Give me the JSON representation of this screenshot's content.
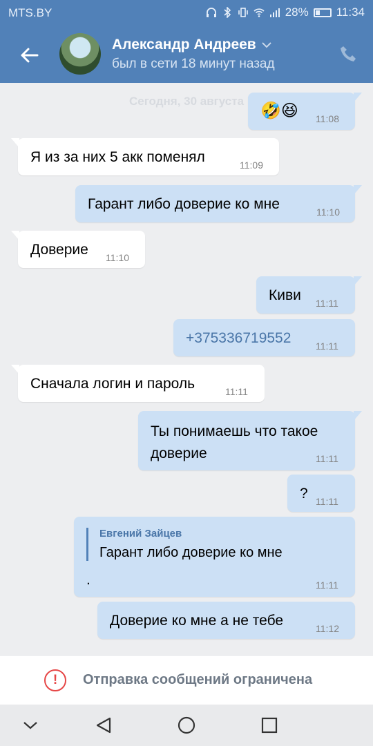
{
  "status_bar": {
    "carrier": "MTS.BY",
    "battery": "28%",
    "time": "11:34"
  },
  "header": {
    "name": "Александр Андреев",
    "last_seen": "был в сети 18 минут назад"
  },
  "chat": {
    "date_divider": "Сегодня, 30 августа",
    "messages": [
      {
        "dir": "out",
        "text": "🤣😆",
        "time": "11:08"
      },
      {
        "dir": "in",
        "text": "Я из за них 5 акк поменял",
        "time": "11:09"
      },
      {
        "dir": "out",
        "text": "Гарант либо доверие ко мне",
        "time": "11:10"
      },
      {
        "dir": "in",
        "text": "Доверие",
        "time": "11:10"
      },
      {
        "dir": "out",
        "text": "Киви",
        "time": "11:11"
      },
      {
        "dir": "out",
        "text": "+375336719552",
        "time": "11:11"
      },
      {
        "dir": "in",
        "text": "Сначала логин и пароль",
        "time": "11:11"
      },
      {
        "dir": "out",
        "text": "Ты понимаешь что такое доверие",
        "time": "11:11"
      },
      {
        "dir": "out",
        "text": "?",
        "time": "11:11"
      },
      {
        "dir": "out",
        "text": ".",
        "time": "11:11",
        "reply_author": "Евгений Зайцев",
        "reply_text": "Гарант либо доверие ко мне"
      },
      {
        "dir": "out",
        "text": "Доверие ко мне а не тебе",
        "time": "11:12"
      }
    ]
  },
  "composer": {
    "restriction": "Отправка сообщений ограничена"
  },
  "colors": {
    "header": "#5181b8",
    "outgoing_bubble": "#cce0f5",
    "incoming_bubble": "#ffffff",
    "warning": "#e64646"
  }
}
